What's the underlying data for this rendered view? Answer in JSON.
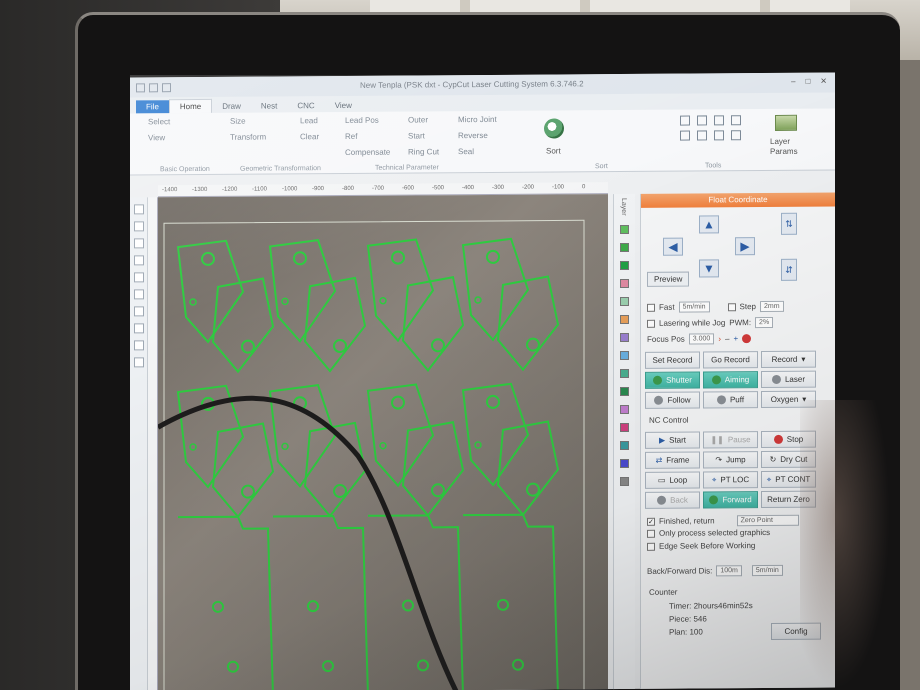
{
  "app": {
    "window_title": "New Tenpla (PSK dxt - CypCut Laser Cutting System 6.3.746.2",
    "tabs": [
      "File",
      "Home",
      "Draw",
      "Nest",
      "CNC",
      "View"
    ]
  },
  "ribbon": {
    "select": "Select",
    "view": "View",
    "size": "Size",
    "transform": "Transform",
    "lead": "Lead",
    "clear": "Clear",
    "lead_pos": "Lead Pos",
    "ref": "Ref",
    "compensate": "Compensate",
    "outer": "Outer",
    "start": "Start",
    "ring_cut": "Ring Cut",
    "micro_joint": "Micro Joint",
    "reverse": "Reverse",
    "seal": "Seal",
    "sort": "Sort",
    "tools": "Tools",
    "layer": "Layer",
    "params": "Params",
    "caption_basic": "Basic Operation",
    "caption_geometric": "Geometric Transformation",
    "caption_technical": "Technical Parameter",
    "caption_sort": "Sort"
  },
  "ruler_ticks": [
    "-1400",
    "-1300",
    "-1200",
    "-1100",
    "-1000",
    "-900",
    "-800",
    "-700",
    "-600",
    "-500",
    "-400",
    "-300",
    "-200",
    "-100",
    "0"
  ],
  "layers": {
    "label": "Layer",
    "colors": [
      "#5fbf5f",
      "#3faa4a",
      "#22a045",
      "#e08aa2",
      "#9bd0b0",
      "#e8a05a",
      "#9a7fd0",
      "#6ab0e0",
      "#4ab090",
      "#2a8a50",
      "#c27fd0",
      "#d04080",
      "#3a9aa0",
      "#4a4ad0",
      "#888888"
    ]
  },
  "panel": {
    "header": "Float Coordinate",
    "preview": "Preview",
    "fast": "Fast",
    "fast_speed": "5m/min",
    "step": "Step",
    "step_value": "2mm",
    "lasering_while_jog": "Lasering while Jog",
    "pwm": "PWM:",
    "pwm_value": "2%",
    "focus_pos": "Focus Pos",
    "focus_value": "3.000",
    "set_record": "Set Record",
    "go_record": "Go Record",
    "record": "Record",
    "shutter": "Shutter",
    "aiming": "Aiming",
    "laser": "Laser",
    "follow": "Follow",
    "puff": "Puff",
    "oxygen": "Oxygen",
    "nc_control": "NC Control",
    "start": "Start",
    "pause": "Pause",
    "stop": "Stop",
    "frame": "Frame",
    "jump": "Jump",
    "dry_cut": "Dry Cut",
    "loop": "Loop",
    "pt_loc": "PT LOC",
    "pt_cont": "PT CONT",
    "back": "Back",
    "forward": "Forward",
    "return_zero": "Return Zero",
    "finished_return": "Finished, return",
    "zero_point": "Zero Point",
    "only_process_selected": "Only process selected graphics",
    "edge_seek": "Edge Seek Before Working",
    "back_forward_dis": "Back/Forward Dis:",
    "back_forward_value": "100m",
    "back_forward_speed": "5m/min",
    "counter": "Counter",
    "timer": "Timer: 2hours46min52s",
    "piece": "Piece: 546",
    "plan": "Plan: 100",
    "config": "Config"
  },
  "colors": {
    "accent_orange": "#f07f3c",
    "shutter_teal": "#3fb5a4",
    "cut_path_green": "#2ecc40",
    "file_tab_blue": "#2d7bd1"
  }
}
